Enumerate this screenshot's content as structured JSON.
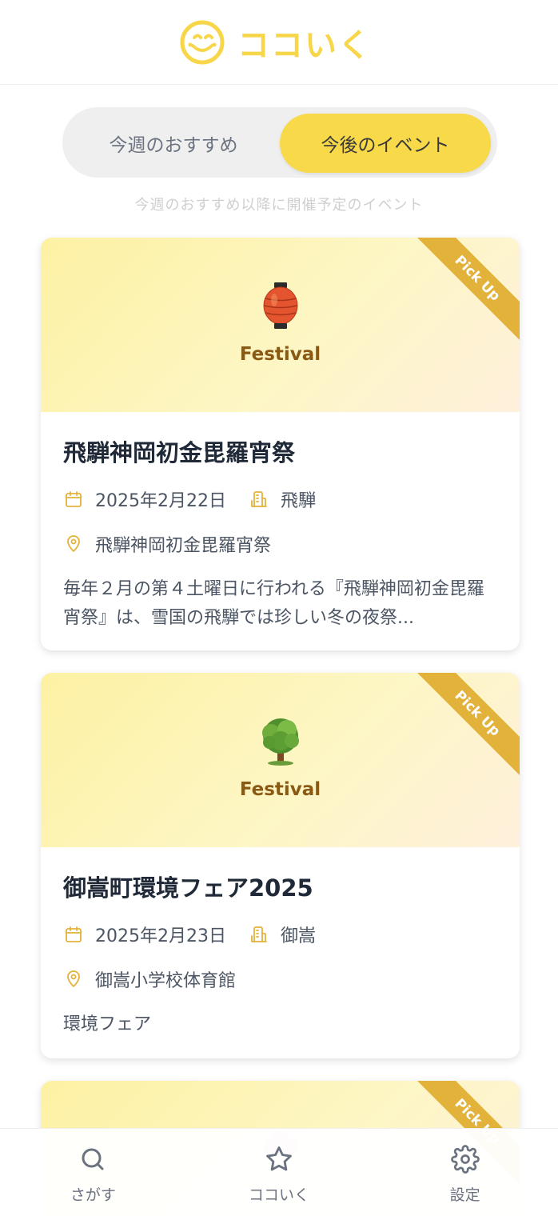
{
  "app": {
    "logo_text": "ココいく",
    "brand_color": "#f7d64a",
    "accent_color": "#e2b23b"
  },
  "tabs": {
    "inactive_label": "今週のおすすめ",
    "active_label": "今後のイベント",
    "selected": "今後のイベント"
  },
  "subtitle": "今週のおすすめ以降に開催予定のイベント",
  "events": [
    {
      "emoji": "🏮",
      "emoji_icon": "lantern-icon",
      "category": "Festival",
      "ribbon": "Pick Up",
      "title": "飛騨神岡初金毘羅宵祭",
      "date": "2025年2月22日",
      "area": "飛騨",
      "venue": "飛騨神岡初金毘羅宵祭",
      "description": "毎年２月の第４土曜日に行われる『飛騨神岡初金毘羅宵祭』は、雪国の飛騨では珍しい冬の夜祭..."
    },
    {
      "emoji": "🌳",
      "emoji_icon": "tree-icon",
      "category": "Festival",
      "ribbon": "Pick Up",
      "title": "御嵩町環境フェア2025",
      "date": "2025年2月23日",
      "area": "御嵩",
      "venue": "御嵩小学校体育館",
      "description": "環境フェア"
    },
    {
      "emoji": "🌸",
      "emoji_icon": "flower-icon",
      "ribbon": "Pick Up"
    }
  ],
  "bottom_nav": [
    {
      "label": "さがす",
      "icon": "search-icon"
    },
    {
      "label": "ココいく",
      "icon": "star-icon"
    },
    {
      "label": "設定",
      "icon": "gear-icon"
    }
  ]
}
